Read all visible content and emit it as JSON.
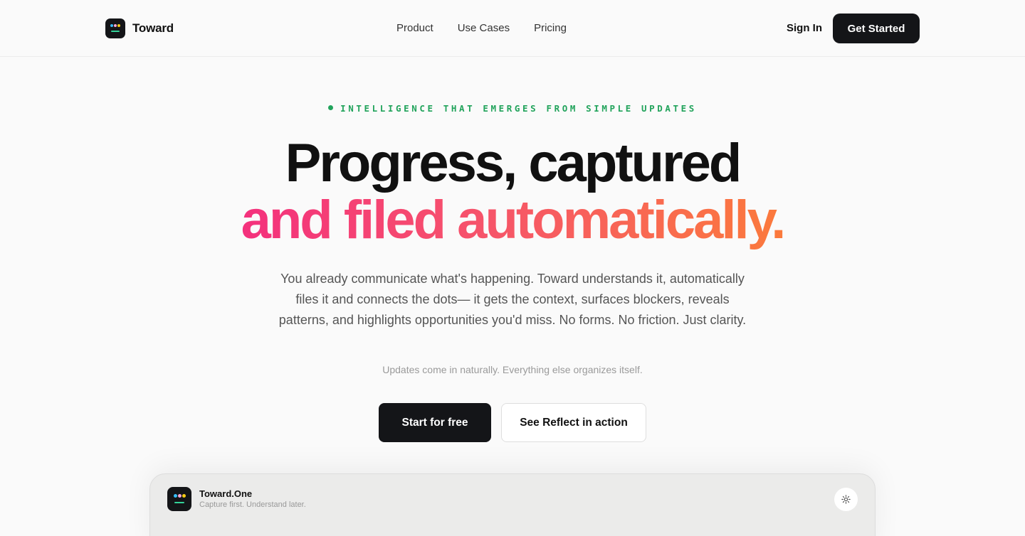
{
  "nav": {
    "brand": "Toward",
    "links": [
      "Product",
      "Use Cases",
      "Pricing"
    ],
    "sign_in": "Sign In",
    "get_started": "Get Started"
  },
  "hero": {
    "eyebrow": "INTELLIGENCE THAT EMERGES FROM SIMPLE UPDATES",
    "headline_line1": "Progress, captured",
    "headline_line2": "and filed automatically.",
    "description": "You already communicate what's happening. Toward understands it, automatically files it and connects the dots— it gets the context, surfaces blockers, reveals patterns, and highlights opportunities you'd miss. No forms. No friction. Just clarity.",
    "tagline": "Updates come in naturally. Everything else organizes itself.",
    "cta_primary": "Start for free",
    "cta_secondary": "See Reflect in action"
  },
  "preview": {
    "title": "Toward.One",
    "subtitle": "Capture first. Understand later."
  },
  "colors": {
    "accent_green": "#21a35b",
    "gradient_start": "#f4317d",
    "gradient_end": "#fb7a3c",
    "dark": "#141518"
  },
  "icons": {
    "brand_logo": "toward-logo-icon",
    "settings": "settings-sun-icon"
  }
}
